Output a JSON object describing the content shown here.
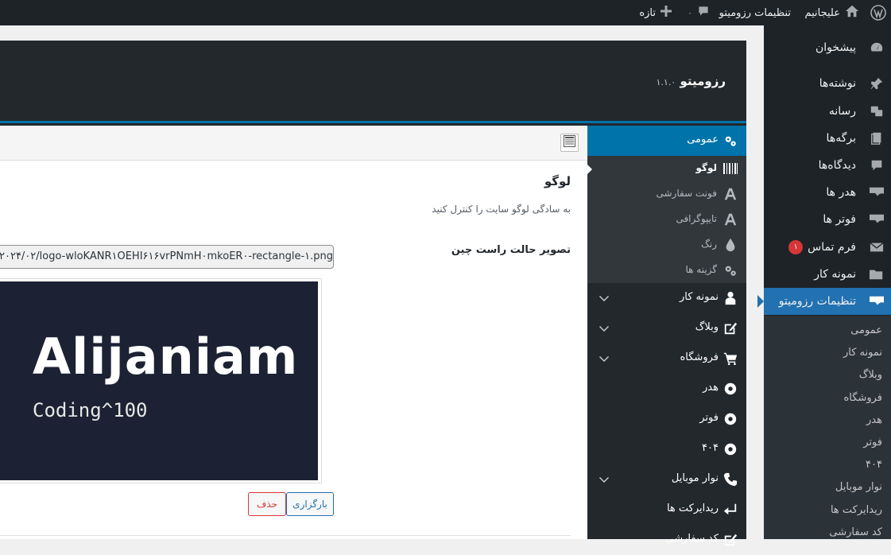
{
  "adminbar": {
    "site_name": "علیجانیم",
    "plugin_link": "تنظیمات رزومیتو",
    "comments_count": "۰",
    "new_label": "تازه"
  },
  "adminmenu": {
    "items": [
      {
        "label": "پیشخوان",
        "icon": "dashboard-icon"
      },
      {
        "label": "نوشته‌ها",
        "icon": "pin-icon"
      },
      {
        "label": "رسانه",
        "icon": "media-icon"
      },
      {
        "label": "برگه‌ها",
        "icon": "pages-icon"
      },
      {
        "label": "دیدگاه‌ها",
        "icon": "comments-icon"
      },
      {
        "label": "هدر ها",
        "icon": "header-icon"
      },
      {
        "label": "فوتر ها",
        "icon": "footer-icon"
      },
      {
        "label": "فرم تماس",
        "icon": "mail-icon",
        "badge": "۱"
      },
      {
        "label": "نمونه کار",
        "icon": "folder-icon"
      },
      {
        "label": "تنظیمات رزومیتو",
        "icon": "settings-flag-icon",
        "current": true
      }
    ],
    "submenu": [
      "عمومی",
      "نمونه کار",
      "وبلاگ",
      "فروشگاه",
      "هدر",
      "فوتر",
      "۴۰۴",
      "نوار موبایل",
      "ریدایرکت ها",
      "کد سفارشی"
    ]
  },
  "plugin": {
    "title": "رزومیتو",
    "version": "۱.۱.۰"
  },
  "sidebar": {
    "items": [
      {
        "label": "عمومی",
        "icon": "gears-icon",
        "active": true
      },
      {
        "label": "نمونه کار",
        "icon": "person-icon"
      },
      {
        "label": "وبلاگ",
        "icon": "edit-icon"
      },
      {
        "label": "فروشگاه",
        "icon": "cart-icon"
      },
      {
        "label": "هدر",
        "icon": "gear-icon"
      },
      {
        "label": "فوتر",
        "icon": "gear-icon"
      },
      {
        "label": "۴۰۴",
        "icon": "gear-icon"
      },
      {
        "label": "نوار موبایل",
        "icon": "phone-icon"
      },
      {
        "label": "ریدایرکت ها",
        "icon": "redirect-icon"
      },
      {
        "label": "کد سفارشی",
        "icon": "code-icon"
      }
    ],
    "subitems": [
      {
        "label": "لوگو",
        "icon": "barcode-icon",
        "current": true
      },
      {
        "label": "فونت سفارشی",
        "icon": "font-icon"
      },
      {
        "label": "تایپوگرافی",
        "icon": "font-icon"
      },
      {
        "label": "رنگ",
        "icon": "drop-icon"
      },
      {
        "label": "گزینه ها",
        "icon": "gears-icon"
      }
    ]
  },
  "panel": {
    "section_title": "لوگو",
    "section_desc": "به سادگی لوگو سایت را کنترل کنید",
    "field_label": "تصویر حالت راست چین",
    "url_value": "۲۰۲۴/۰۲/logo-wloKANR۱OEHI۶۱۶vrPNmH۰mkoER۰-rectangle-۱.png",
    "logo_text": "Alijaniam",
    "logo_tagline": "Coding^100",
    "upload_label": "بارگزاری",
    "remove_label": "حذف"
  }
}
